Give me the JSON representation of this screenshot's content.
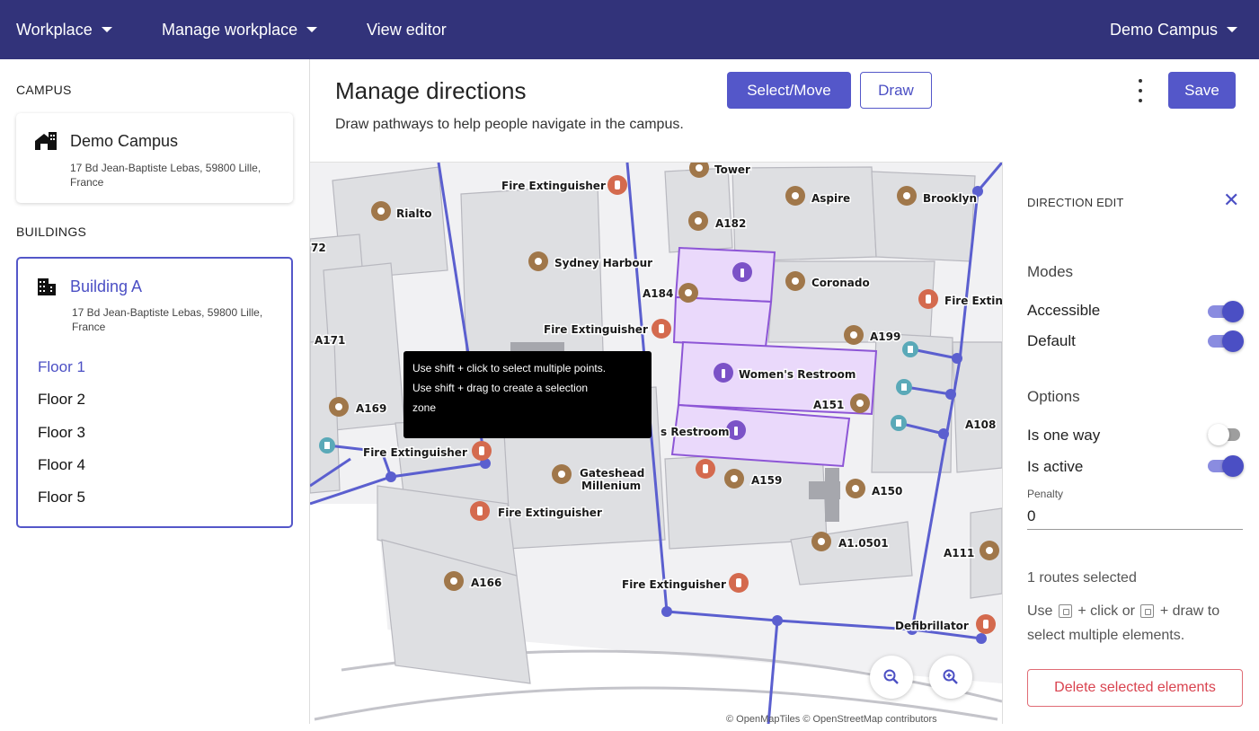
{
  "topnav": {
    "workplace": "Workplace",
    "manage_workplace": "Manage workplace",
    "view_editor": "View editor",
    "campus_selector": "Demo Campus"
  },
  "sidebar": {
    "campus_label": "CAMPUS",
    "campus": {
      "name": "Demo Campus",
      "address": "17 Bd Jean-Baptiste Lebas, 59800 Lille, France"
    },
    "buildings_label": "BUILDINGS",
    "building": {
      "name": "Building A",
      "address": "17 Bd Jean-Baptiste Lebas, 59800 Lille, France"
    },
    "floors": [
      {
        "label": "Floor 1",
        "active": true
      },
      {
        "label": "Floor 2",
        "active": false
      },
      {
        "label": "Floor 3",
        "active": false
      },
      {
        "label": "Floor 4",
        "active": false
      },
      {
        "label": "Floor 5",
        "active": false
      }
    ]
  },
  "header": {
    "title": "Manage directions",
    "subtitle": "Draw pathways to help people navigate in the campus.",
    "select_move": "Select/Move",
    "draw": "Draw",
    "save": "Save"
  },
  "map": {
    "tooltip_lines": [
      "Use shift + click to select multiple points.",
      "Use shift + drag to create a selection",
      "zone"
    ],
    "labels": [
      "Tower",
      "Aspire",
      "Brooklyn",
      "Rialto",
      "Fire Extinguisher",
      "A182",
      "72",
      "Sydney Harbour",
      "Coronado",
      "A184",
      "Fire Extin",
      "Fire Extinguisher",
      "A199",
      "A171",
      "Women's Restroom",
      "A151",
      "A169",
      "s Restroom",
      "A108",
      "Fire Extinguisher",
      "Gateshead",
      "Millenium",
      "A159",
      "A150",
      "Fire Extinguisher",
      "A1.0501",
      "A111",
      "A166",
      "Fire Extinguisher",
      "Defibrillator"
    ],
    "attribution": "© OpenMapTiles © OpenStreetMap contributors",
    "colors": {
      "path": "#5b5fcf",
      "room_selected": "#ead9fb",
      "room": "#dedfe2",
      "poi_brown": "#a0774a",
      "poi_red": "#d46a4e",
      "poi_purple": "#7b52c7",
      "poi_teal": "#5aa9b8"
    }
  },
  "panel": {
    "title": "DIRECTION EDIT",
    "modes_label": "Modes",
    "modes": [
      {
        "label": "Accessible",
        "on": true
      },
      {
        "label": "Default",
        "on": true
      }
    ],
    "options_label": "Options",
    "options": [
      {
        "label": "Is one way",
        "on": false
      },
      {
        "label": "Is active",
        "on": true
      }
    ],
    "penalty_label": "Penalty",
    "penalty_value": "0",
    "routes_selected": "1 routes selected",
    "help_parts": [
      "Use",
      "+ click or",
      "+ draw",
      "to select multiple elements."
    ],
    "delete_label": "Delete selected elements"
  },
  "theme": {
    "nav_bg": "#32337a",
    "accent": "#5457c9",
    "danger": "#d9434f"
  }
}
